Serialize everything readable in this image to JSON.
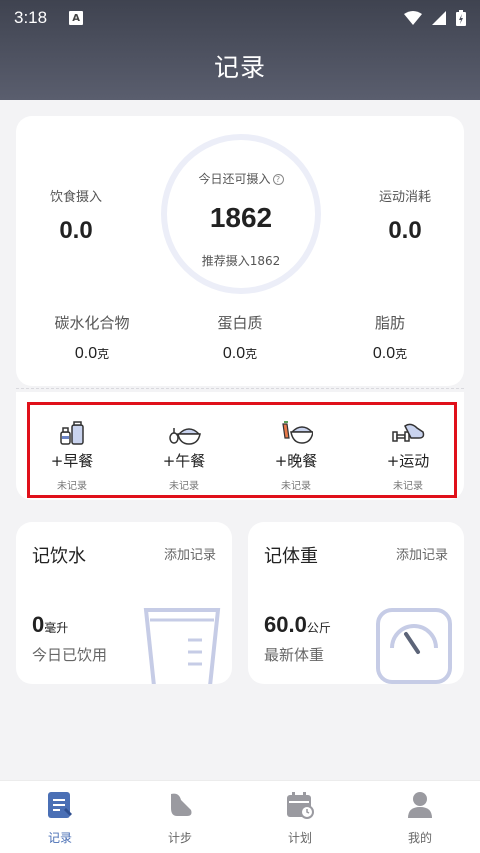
{
  "status_bar": {
    "time": "3:18",
    "notif_letter": "A"
  },
  "header": {
    "title": "记录"
  },
  "summary": {
    "diet_label": "饮食摄入",
    "diet_value": "0.0",
    "remaining_label": "今日还可摄入",
    "remaining_value": "1862",
    "recommended_label": "推荐摄入1862",
    "exercise_label": "运动消耗",
    "exercise_value": "0.0",
    "macros": [
      {
        "label": "碳水化合物",
        "value": "0.0",
        "unit": "克"
      },
      {
        "label": "蛋白质",
        "value": "0.0",
        "unit": "克"
      },
      {
        "label": "脂肪",
        "value": "0.0",
        "unit": "克"
      }
    ]
  },
  "meals": [
    {
      "label": "+早餐",
      "status": "未记录",
      "icon": "breakfast-icon"
    },
    {
      "label": "+午餐",
      "status": "未记录",
      "icon": "lunch-icon"
    },
    {
      "label": "+晚餐",
      "status": "未记录",
      "icon": "dinner-icon"
    },
    {
      "label": "+运动",
      "status": "未记录",
      "icon": "exercise-icon"
    }
  ],
  "water": {
    "title": "记饮水",
    "add": "添加记录",
    "value": "0",
    "unit": "毫升",
    "desc": "今日已饮用"
  },
  "weight": {
    "title": "记体重",
    "add": "添加记录",
    "value": "60.0",
    "unit": "公斤",
    "desc": "最新体重"
  },
  "nav": [
    {
      "label": "记录",
      "icon": "record-icon",
      "active": true
    },
    {
      "label": "计步",
      "icon": "shoe-icon",
      "active": false
    },
    {
      "label": "计划",
      "icon": "calendar-icon",
      "active": false
    },
    {
      "label": "我的",
      "icon": "profile-icon",
      "active": false
    }
  ],
  "colors": {
    "accent": "#4a6fb5",
    "highlight": "#e0101a",
    "header": "#4a4e5c"
  }
}
